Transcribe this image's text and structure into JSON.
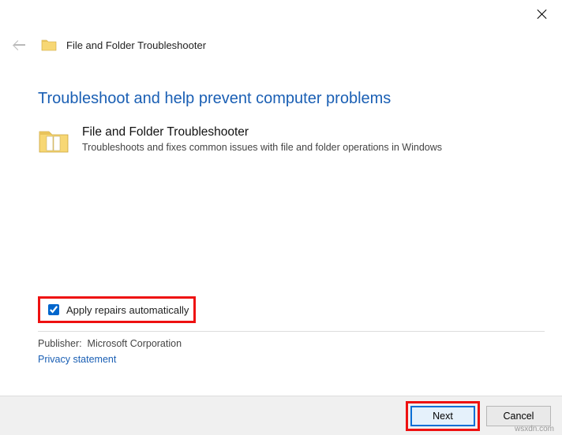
{
  "window": {
    "title": "File and Folder Troubleshooter"
  },
  "main": {
    "heading": "Troubleshoot and help prevent computer problems",
    "item_title": "File and Folder Troubleshooter",
    "item_desc": "Troubleshoots and fixes common issues with file and folder operations in Windows"
  },
  "options": {
    "apply_label": "Apply repairs automatically"
  },
  "meta": {
    "publisher_label": "Publisher:",
    "publisher_value": "Microsoft Corporation",
    "privacy_link": "Privacy statement"
  },
  "footer": {
    "next": "Next",
    "cancel": "Cancel"
  },
  "watermark": "wsxdn.com"
}
